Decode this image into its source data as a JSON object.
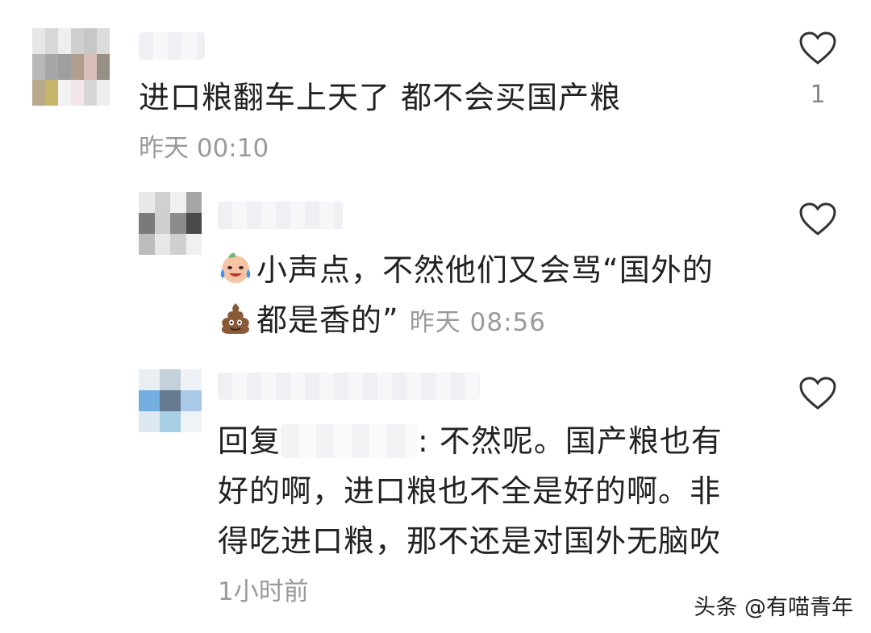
{
  "comments": [
    {
      "text": "进口粮翻车上天了    都不会买国产粮",
      "time": "昨天 00:10",
      "likes": "1",
      "avatar_colors": [
        "#e7e7e7",
        "#d7d7d7",
        "#eeeeee",
        "#cfcfcf",
        "#c7c7c7",
        "#dbdbdb",
        "#b8b8b8",
        "#a7a7a7",
        "#9e9e9e",
        "#b09f8d",
        "#d8bfb8",
        "#958f86",
        "#b7a98a",
        "#c7b56c",
        "#f2f2f2",
        "#f3e6ea",
        "#d6d6d6",
        "#eeeeee"
      ]
    },
    {
      "text_line1": "小声点，不然他们又会骂“国外的",
      "text_line2": "都是香的”",
      "time": "昨天 08:56",
      "avatar_colors": [
        "#e8e8e8",
        "#d0d0d0",
        "#f1f1f1",
        "#a6a6a6",
        "#7a7a7a",
        "#cfcfcf",
        "#8c8c8c",
        "#4a4a4a",
        "#bdbdbd",
        "#e7e7e7",
        "#cfcfcf",
        "#f0f0f0"
      ]
    },
    {
      "text_prefix": "回复",
      "text_suffix": ": 不然呢。国产粮也有",
      "text_line2": "好的啊，进口粮也不全是好的啊。非",
      "text_line3": "得吃进口粮，那不还是对国外无脑吹",
      "time": "1小时前",
      "avatar_colors": [
        "#e9eef3",
        "#c4d0da",
        "#eef2f6",
        "#73aee1",
        "#667a8f",
        "#a9c9e6",
        "#dce7f0",
        "#a6cfe3",
        "#edf3f7"
      ]
    }
  ],
  "watermark": "头条 @有喵青年"
}
